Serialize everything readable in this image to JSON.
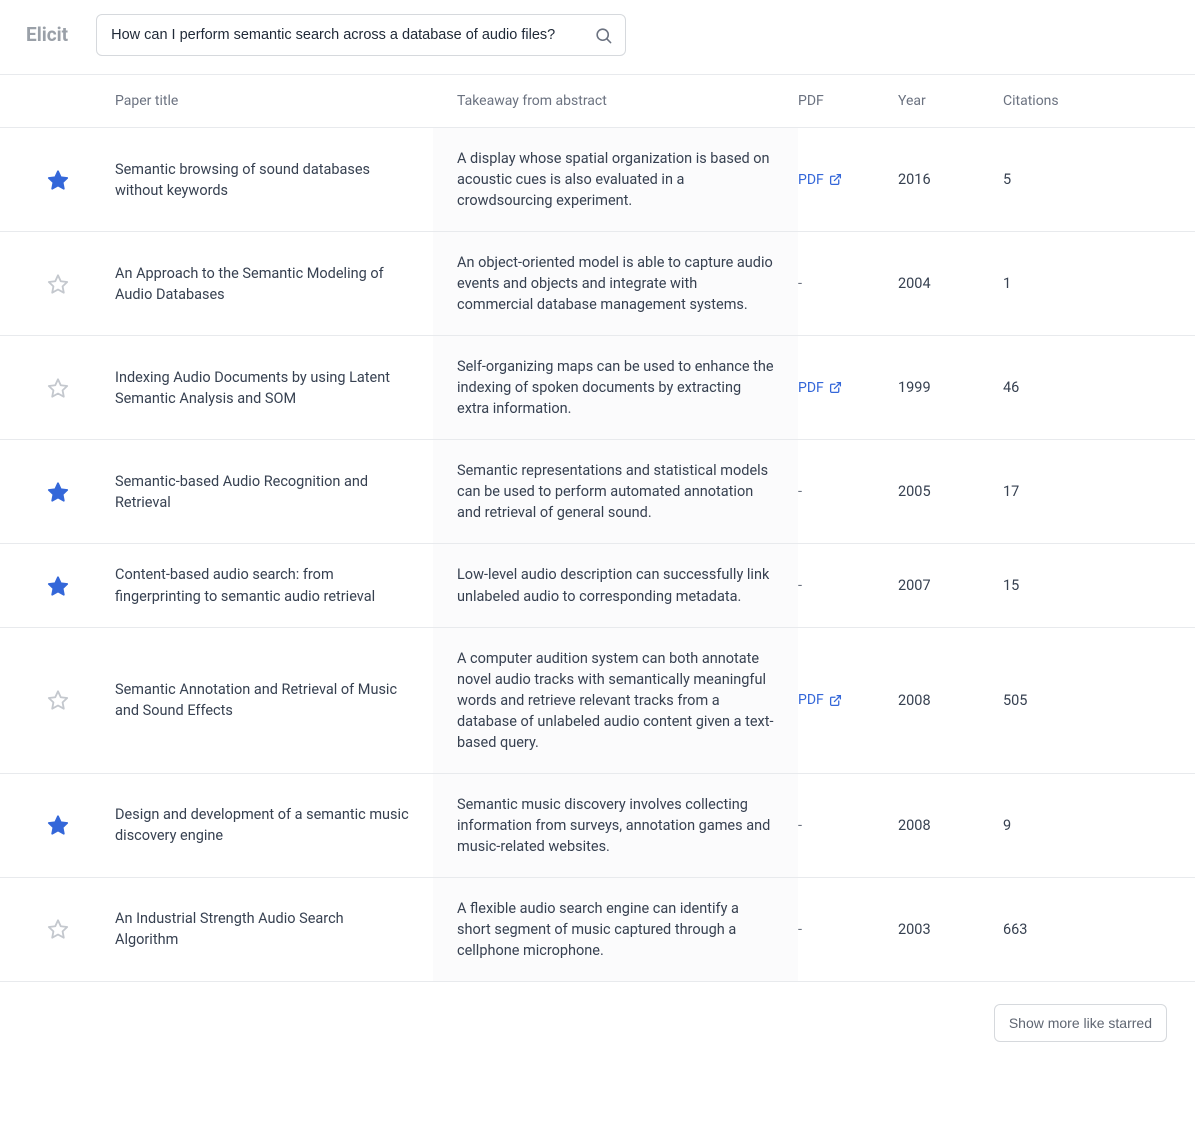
{
  "header": {
    "logo": "Elicit",
    "search_value": "How can I perform semantic search across a database of audio files?"
  },
  "columns": {
    "title": "Paper title",
    "takeaway": "Takeaway from abstract",
    "pdf": "PDF",
    "year": "Year",
    "citations": "Citations"
  },
  "pdf_label": "PDF",
  "pdf_empty": "-",
  "rows": [
    {
      "starred": true,
      "title": "Semantic browsing of sound databases without keywords",
      "takeaway": "A display whose spatial organization is based on acoustic cues is also evaluated in a crowdsourcing experiment.",
      "pdf": true,
      "year": "2016",
      "citations": "5"
    },
    {
      "starred": false,
      "title": "An Approach to the Semantic Modeling of Audio Databases",
      "takeaway": "An object-oriented model is able to capture audio events and objects and integrate with commercial database management systems.",
      "pdf": false,
      "year": "2004",
      "citations": "1"
    },
    {
      "starred": false,
      "title": "Indexing Audio Documents by using Latent Semantic Analysis and SOM",
      "takeaway": "Self-organizing maps can be used to enhance the indexing of spoken documents by extracting extra information.",
      "pdf": true,
      "year": "1999",
      "citations": "46"
    },
    {
      "starred": true,
      "title": "Semantic-based Audio Recognition and Retrieval",
      "takeaway": "Semantic representations and statistical models can be used to perform automated annotation and retrieval of general sound.",
      "pdf": false,
      "year": "2005",
      "citations": "17"
    },
    {
      "starred": true,
      "title": "Content-based audio search: from fingerprinting to semantic audio retrieval",
      "takeaway": "Low-level audio description can successfully link unlabeled audio to corresponding metadata.",
      "pdf": false,
      "year": "2007",
      "citations": "15"
    },
    {
      "starred": false,
      "title": "Semantic Annotation and Retrieval of Music and Sound Effects",
      "takeaway": "A computer audition system can both annotate novel audio tracks with semantically meaningful words and retrieve relevant tracks from a database of unlabeled audio content given a text-based query.",
      "pdf": true,
      "year": "2008",
      "citations": "505"
    },
    {
      "starred": true,
      "title": "Design and development of a semantic music discovery engine",
      "takeaway": "Semantic music discovery involves collecting information from surveys, annotation games and music-related websites.",
      "pdf": false,
      "year": "2008",
      "citations": "9"
    },
    {
      "starred": false,
      "title": "An Industrial Strength Audio Search Algorithm",
      "takeaway": "A flexible audio search engine can identify a short segment of music captured through a cellphone microphone.",
      "pdf": false,
      "year": "2003",
      "citations": "663"
    }
  ],
  "footer": {
    "show_more_label": "Show more like starred"
  }
}
